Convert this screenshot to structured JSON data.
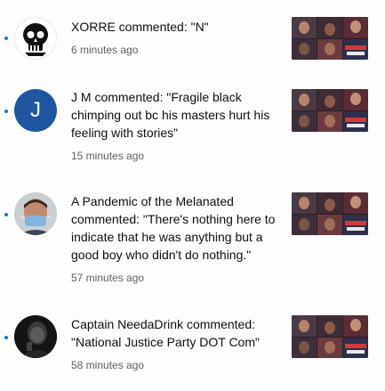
{
  "notifications": [
    {
      "avatar_icon": "skull-icon",
      "message": "XORRE commented: \"N\"",
      "time": "6 minutes ago",
      "unread": true
    },
    {
      "avatar_icon": "letter-avatar",
      "avatar_letter": "J",
      "avatar_color": "#1e56a0",
      "message": "J M commented: \"Fragile black chimping out bc his masters hurt his feeling with stories\"",
      "time": "15 minutes ago",
      "unread": true
    },
    {
      "avatar_icon": "masked-person-icon",
      "message": "A Pandemic of the Melanated commented: \"There's nothing here to indicate that he was anything but a good boy who didn't do nothing.\"",
      "time": "57 minutes ago",
      "unread": true
    },
    {
      "avatar_icon": "dark-portrait-icon",
      "message": "Captain NeedaDrink commented: \"National Justice Party DOT Com\"",
      "time": "58 minutes ago",
      "unread": true
    }
  ],
  "colors": {
    "unread_dot": "#1a73e8",
    "primary_text": "#0f0f0f",
    "secondary_text": "#606060"
  }
}
